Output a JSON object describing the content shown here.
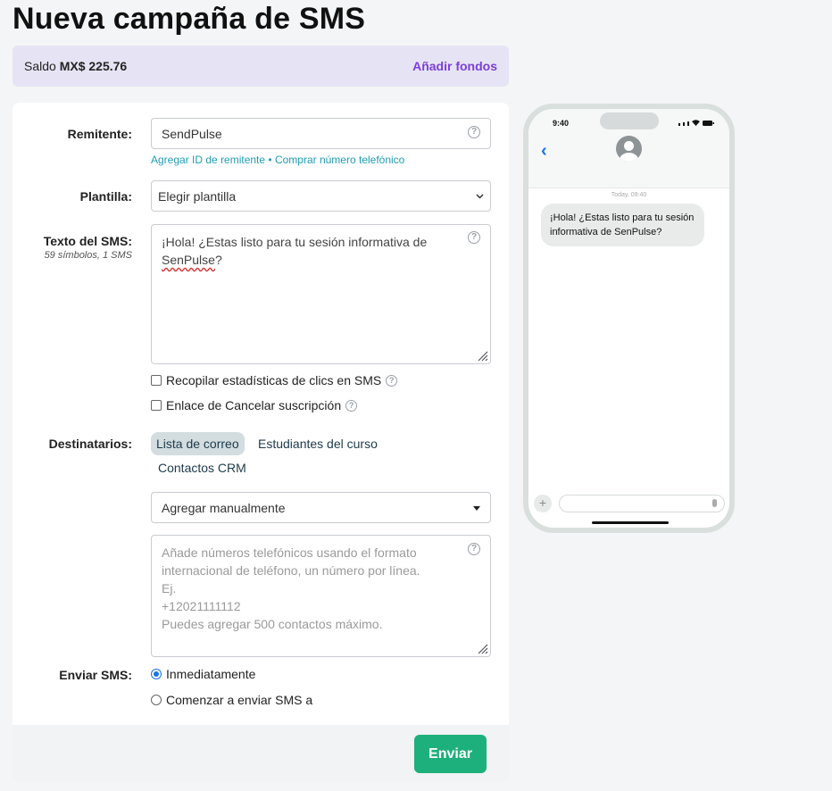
{
  "page": {
    "title": "Nueva campaña de SMS"
  },
  "balance": {
    "label": "Saldo",
    "amount": "MX$ 225.76",
    "add_funds": "Añadir fondos"
  },
  "sender": {
    "label": "Remitente:",
    "value": "SendPulse",
    "link_add_id": "Agregar ID de remitente",
    "separator": "•",
    "link_buy_number": "Comprar número telefónico"
  },
  "template": {
    "label": "Plantilla:",
    "selected": "Elegir plantilla"
  },
  "sms_text": {
    "label": "Texto del SMS:",
    "counter": "59 símbolos, 1 SMS",
    "value_part1": "¡Hola! ¿Estas listo para tu sesión informativa de",
    "value_misspelled": "SenPulse",
    "value_part2": "?"
  },
  "options": {
    "collect_clicks": "Recopilar estadísticas de clics en SMS",
    "unsubscribe_link": "Enlace de Cancelar suscripción"
  },
  "recipients": {
    "label": "Destinatarios:",
    "tabs": [
      "Lista de correo",
      "Estudiantes del curso",
      "Contactos CRM"
    ],
    "dropdown_selected": "Agregar manualmente",
    "placeholder_lines": [
      "Añade números  telefónicos usando el formato",
      "internacional de teléfono, un número por línea.",
      "Ej.",
      "+12021111112",
      "Puedes agregar 500 contactos máximo."
    ]
  },
  "send_sms": {
    "label": "Enviar SMS:",
    "option_now": "Inmediatamente",
    "option_schedule": "Comenzar a enviar SMS a"
  },
  "actions": {
    "send": "Enviar"
  },
  "preview": {
    "time": "9:40",
    "today": "Today, 09:40",
    "message": "¡Hola! ¿Estas listo para tu sesión informativa de SenPulse?"
  },
  "colors": {
    "accent_purple": "#7b3fd6",
    "link_teal": "#1f9eb5",
    "send_green": "#1eb07c",
    "balance_bg": "#e6e4f4"
  }
}
